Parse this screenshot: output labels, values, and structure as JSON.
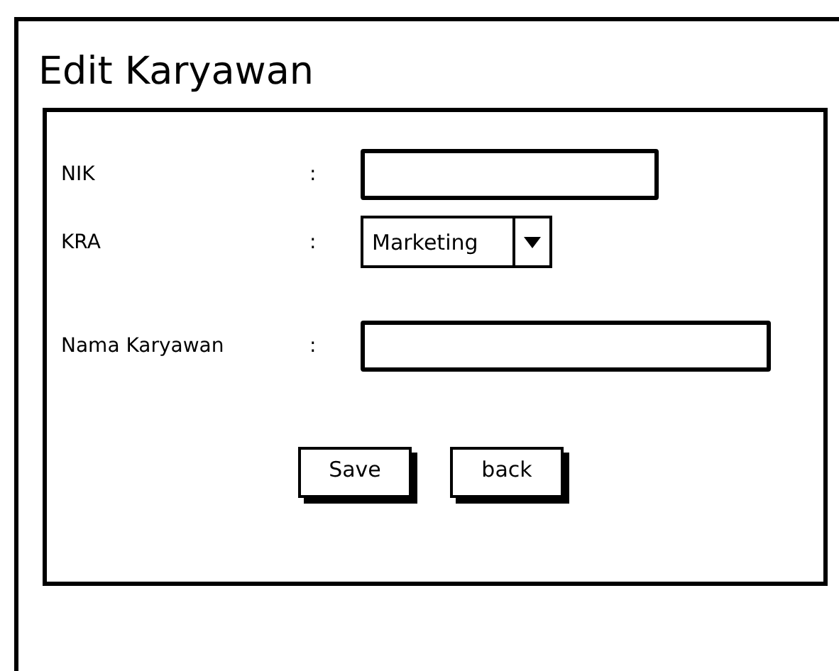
{
  "title": "Edit Karyawan",
  "fields": [
    {
      "label": "NIK",
      "separator": ":",
      "kind": "text"
    },
    {
      "label": "KRA",
      "separator": ":",
      "kind": "select",
      "value": "Marketing"
    },
    {
      "label": "Nama Karyawan",
      "separator": ":",
      "kind": "text"
    }
  ],
  "buttons": [
    "Save",
    "back"
  ]
}
